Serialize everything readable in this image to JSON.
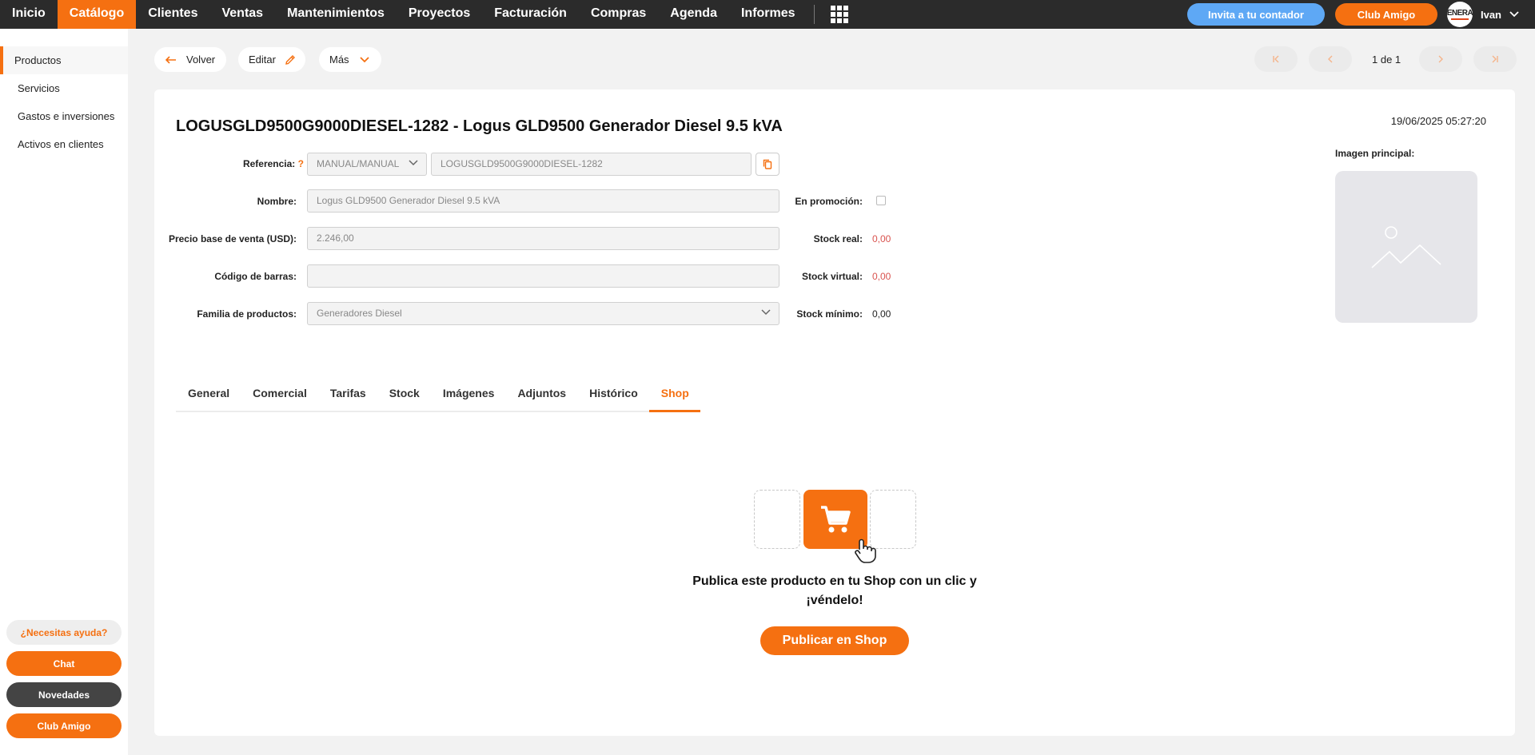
{
  "topnav": {
    "items": [
      "Inicio",
      "Catálogo",
      "Clientes",
      "Ventas",
      "Mantenimientos",
      "Proyectos",
      "Facturación",
      "Compras",
      "Agenda",
      "Informes"
    ],
    "active": "Catálogo",
    "invite_label": "Invita a tu contador",
    "club_label": "Club Amigo",
    "avatar_text": "ENERA",
    "user_name": "Ivan"
  },
  "sidebar": {
    "items": [
      "Productos",
      "Servicios",
      "Gastos e inversiones",
      "Activos en clientes"
    ],
    "active": "Productos",
    "help_label": "¿Necesitas ayuda?",
    "chat_label": "Chat",
    "news_label": "Novedades",
    "club_label": "Club Amigo"
  },
  "toolbar": {
    "back_label": "Volver",
    "edit_label": "Editar",
    "more_label": "Más",
    "pager_text": "1 de 1"
  },
  "product": {
    "title": "LOGUSGLD9500G9000DIESEL-1282 - Logus GLD9500 Generador Diesel 9.5 kVA",
    "timestamp": "19/06/2025 05:27:20",
    "reference_label": "Referencia:",
    "reference_help": "?",
    "reference_type": "MANUAL/MANUAL",
    "reference_value": "LOGUSGLD9500G9000DIESEL-1282",
    "name_label": "Nombre:",
    "name_value": "Logus GLD9500 Generador Diesel 9.5 kVA",
    "price_label": "Precio base de venta (USD):",
    "price_value": "2.246,00",
    "barcode_label": "Código de barras:",
    "barcode_value": "",
    "family_label": "Familia de productos:",
    "family_value": "Generadores Diesel",
    "promo_label": "En promoción:",
    "promo_checked": false,
    "stock_real_label": "Stock real:",
    "stock_real_value": "0,00",
    "stock_virtual_label": "Stock virtual:",
    "stock_virtual_value": "0,00",
    "stock_min_label": "Stock mínimo:",
    "stock_min_value": "0,00",
    "image_label": "Imagen principal:"
  },
  "tabs": {
    "items": [
      "General",
      "Comercial",
      "Tarifas",
      "Stock",
      "Imágenes",
      "Adjuntos",
      "Histórico",
      "Shop"
    ],
    "active": "Shop"
  },
  "shop": {
    "promo_line1": "Publica este producto en tu Shop con un clic y",
    "promo_line2": "¡véndelo!",
    "publish_label": "Publicar en Shop"
  },
  "colors": {
    "accent": "#f57011",
    "topbar": "#2b2b2b",
    "invite": "#5ea8f5",
    "stock_red": "#d9534f"
  }
}
